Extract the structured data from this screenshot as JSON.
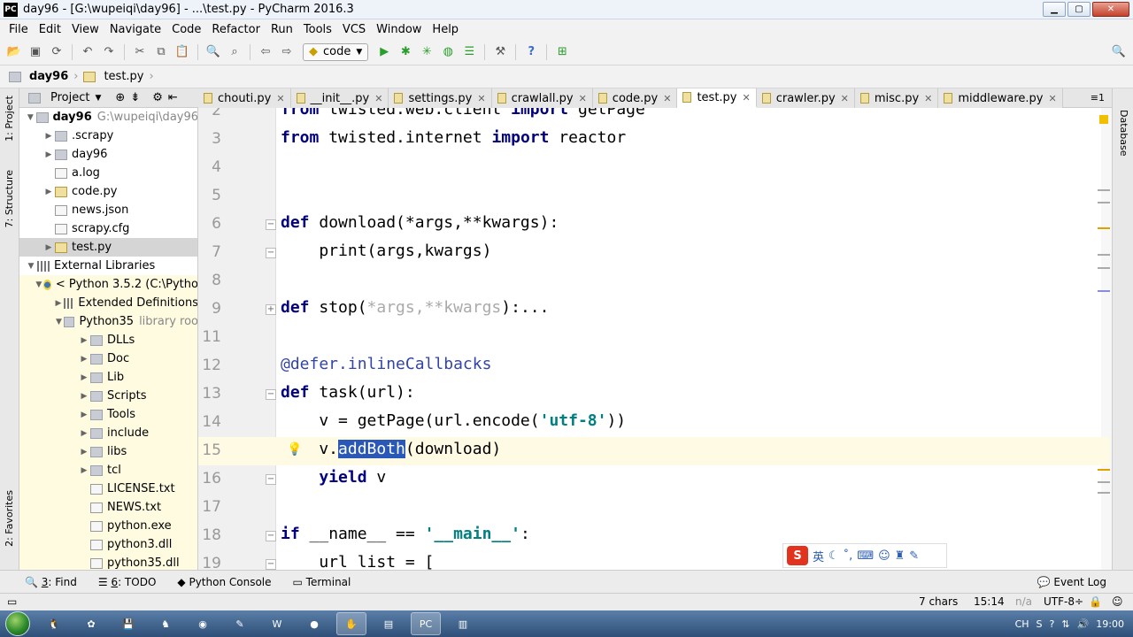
{
  "window": {
    "title": "day96 - [G:\\wupeiqi\\day96] - ...\\test.py - PyCharm 2016.3",
    "logo": "PC"
  },
  "menu": [
    "File",
    "Edit",
    "View",
    "Navigate",
    "Code",
    "Refactor",
    "Run",
    "Tools",
    "VCS",
    "Window",
    "Help"
  ],
  "toolbar": {
    "run_config": "code"
  },
  "breadcrumb": {
    "project": "day96",
    "file": "test.py"
  },
  "side_tools": {
    "project": "1: Project",
    "structure": "7: Structure",
    "favorites": "2: Favorites",
    "database": "Database"
  },
  "project_panel": {
    "title": "Project"
  },
  "tree": [
    {
      "label": "day96",
      "extra": "G:\\wupeiqi\\day96",
      "level": 0,
      "arrow": "▼",
      "icon": "folder",
      "bold": true
    },
    {
      "label": ".scrapy",
      "level": 1,
      "arrow": "▶",
      "icon": "folder"
    },
    {
      "label": "day96",
      "level": 1,
      "arrow": "▶",
      "icon": "folder"
    },
    {
      "label": "a.log",
      "level": 1,
      "arrow": "",
      "icon": "file"
    },
    {
      "label": "code.py",
      "level": 1,
      "arrow": "▶",
      "icon": "py"
    },
    {
      "label": "news.json",
      "level": 1,
      "arrow": "",
      "icon": "file"
    },
    {
      "label": "scrapy.cfg",
      "level": 1,
      "arrow": "",
      "icon": "file"
    },
    {
      "label": "test.py",
      "level": 1,
      "arrow": "▶",
      "icon": "py",
      "selected": true
    },
    {
      "label": "External Libraries",
      "level": 0,
      "arrow": "▼",
      "icon": "lib"
    },
    {
      "label": "< Python 3.5.2 (C:\\Pytho",
      "level": 1,
      "arrow": "▼",
      "icon": "python",
      "ext": true
    },
    {
      "label": "Extended Definitions",
      "level": 2,
      "arrow": "▶",
      "icon": "lib",
      "ext": true
    },
    {
      "label": "Python35",
      "extra": "library roo",
      "level": 2,
      "arrow": "▼",
      "icon": "folder",
      "ext": true
    },
    {
      "label": "DLLs",
      "level": 3,
      "arrow": "▶",
      "icon": "folder",
      "ext": true
    },
    {
      "label": "Doc",
      "level": 3,
      "arrow": "▶",
      "icon": "folder",
      "ext": true
    },
    {
      "label": "Lib",
      "level": 3,
      "arrow": "▶",
      "icon": "folder",
      "ext": true
    },
    {
      "label": "Scripts",
      "level": 3,
      "arrow": "▶",
      "icon": "folder",
      "ext": true
    },
    {
      "label": "Tools",
      "level": 3,
      "arrow": "▶",
      "icon": "folder",
      "ext": true
    },
    {
      "label": "include",
      "level": 3,
      "arrow": "▶",
      "icon": "folder",
      "ext": true
    },
    {
      "label": "libs",
      "level": 3,
      "arrow": "▶",
      "icon": "folder",
      "ext": true
    },
    {
      "label": "tcl",
      "level": 3,
      "arrow": "▶",
      "icon": "folder",
      "ext": true
    },
    {
      "label": "LICENSE.txt",
      "level": 3,
      "arrow": "",
      "icon": "file",
      "ext": true
    },
    {
      "label": "NEWS.txt",
      "level": 3,
      "arrow": "",
      "icon": "file",
      "ext": true
    },
    {
      "label": "python.exe",
      "level": 3,
      "arrow": "",
      "icon": "file",
      "ext": true
    },
    {
      "label": "python3.dll",
      "level": 3,
      "arrow": "",
      "icon": "file",
      "ext": true
    },
    {
      "label": "python35.dll",
      "level": 3,
      "arrow": "",
      "icon": "file",
      "ext": true
    }
  ],
  "tabs": [
    {
      "label": "chouti.py"
    },
    {
      "label": "__init__.py"
    },
    {
      "label": "settings.py"
    },
    {
      "label": "crawlall.py"
    },
    {
      "label": "code.py"
    },
    {
      "label": "test.py",
      "active": true
    },
    {
      "label": "crawler.py"
    },
    {
      "label": "misc.py"
    },
    {
      "label": "middleware.py"
    }
  ],
  "tabs_more": "≡1",
  "code_lines": [
    {
      "num": "2",
      "segments": [
        {
          "t": "from",
          "c": "kw"
        },
        {
          "t": " twisted.web.client "
        },
        {
          "t": "import",
          "c": "kw"
        },
        {
          "t": " getPage"
        }
      ]
    },
    {
      "num": "3",
      "segments": [
        {
          "t": "from",
          "c": "kw"
        },
        {
          "t": " twisted.internet "
        },
        {
          "t": "import",
          "c": "kw"
        },
        {
          "t": " reactor"
        }
      ]
    },
    {
      "num": "4",
      "segments": []
    },
    {
      "num": "5",
      "segments": []
    },
    {
      "num": "6",
      "fold": "−",
      "segments": [
        {
          "t": "def",
          "c": "kw"
        },
        {
          "t": " download(*args,**kwargs):"
        }
      ]
    },
    {
      "num": "7",
      "fold": "−",
      "segments": [
        {
          "t": "    print(args,kwargs)"
        }
      ]
    },
    {
      "num": "8",
      "segments": []
    },
    {
      "num": "9",
      "fold": "+",
      "segments": [
        {
          "t": "def",
          "c": "kw"
        },
        {
          "t": " stop("
        },
        {
          "t": "*args,**kwargs",
          "c": "fold"
        },
        {
          "t": "):..."
        }
      ]
    },
    {
      "num": "11",
      "segments": []
    },
    {
      "num": "12",
      "segments": [
        {
          "t": "@defer.inlineCallbacks",
          "c": "deco"
        }
      ]
    },
    {
      "num": "13",
      "fold": "−",
      "segments": [
        {
          "t": "def",
          "c": "kw"
        },
        {
          "t": " task(url):"
        }
      ]
    },
    {
      "num": "14",
      "segments": [
        {
          "t": "    v = getPage(url.encode("
        },
        {
          "t": "'utf-8'",
          "c": "str"
        },
        {
          "t": "))"
        }
      ]
    },
    {
      "num": "15",
      "current": true,
      "bulb": true,
      "segments": [
        {
          "t": "    v."
        },
        {
          "t": "addBoth",
          "c": "hl"
        },
        {
          "t": "(download)"
        }
      ]
    },
    {
      "num": "16",
      "fold": "−",
      "segments": [
        {
          "t": "    "
        },
        {
          "t": "yield",
          "c": "kw"
        },
        {
          "t": " v"
        }
      ]
    },
    {
      "num": "17",
      "segments": []
    },
    {
      "num": "18",
      "fold": "−",
      "segments": [
        {
          "t": "if",
          "c": "kw"
        },
        {
          "t": " __name__ == "
        },
        {
          "t": "'__main__'",
          "c": "str"
        },
        {
          "t": ":"
        }
      ]
    },
    {
      "num": "19",
      "fold": "−",
      "segments": [
        {
          "t": "    url_list = ["
        }
      ]
    }
  ],
  "ime": {
    "logo": "S",
    "lang": "英"
  },
  "tool_windows": [
    {
      "key": "3",
      "label": ": Find",
      "icon": "search-icon"
    },
    {
      "key": "6",
      "label": ": TODO",
      "icon": "todo-icon"
    },
    {
      "key": "",
      "label": "Python Console",
      "icon": "python-icon"
    },
    {
      "key": "",
      "label": "Terminal",
      "icon": "terminal-icon"
    }
  ],
  "event_log": "Event Log",
  "status": {
    "chars": "7 chars",
    "pos": "15:14",
    "sep": "n/a",
    "encoding": "UTF-8÷"
  },
  "taskbar": {
    "time": "19:00",
    "lang": "CH"
  }
}
